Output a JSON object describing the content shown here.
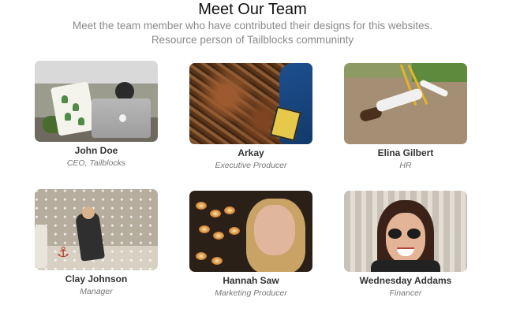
{
  "header": {
    "title": "Meet Our Team",
    "subtitle": "Meet the team member who have contributed their designs for this websites. Resource person of Tailblocks communinty"
  },
  "members": [
    {
      "name": "John Doe",
      "role": "CEO, Tailblocks"
    },
    {
      "name": "Arkay",
      "role": "Executive Producer"
    },
    {
      "name": "Elina Gilbert",
      "role": "HR"
    },
    {
      "name": "Clay Johnson",
      "role": "Manager"
    },
    {
      "name": "Hannah Saw",
      "role": "Marketing Producer"
    },
    {
      "name": "Wednesday Addams",
      "role": "Financer"
    }
  ]
}
